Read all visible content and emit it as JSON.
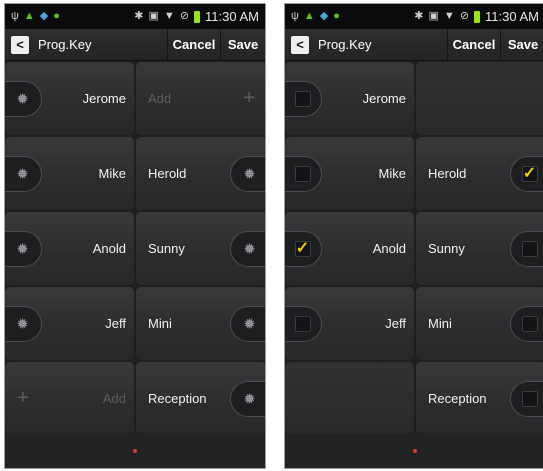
{
  "status": {
    "time": "11:30 AM"
  },
  "header": {
    "title": "Prog.Key",
    "cancel": "Cancel",
    "save": "Save"
  },
  "left": {
    "rows": [
      {
        "left": "Jerome",
        "right": "Add"
      },
      {
        "left": "Mike",
        "right": "Herold"
      },
      {
        "left": "Anold",
        "right": "Sunny"
      },
      {
        "left": "Jeff",
        "right": "Mini"
      },
      {
        "left": "Add",
        "right": "Reception"
      }
    ]
  },
  "right": {
    "rows": [
      {
        "left": "Jerome",
        "left_checked": false
      },
      {
        "left": "Mike",
        "left_checked": false,
        "right": "Herold",
        "right_checked": true
      },
      {
        "left": "Anold",
        "left_checked": true,
        "right": "Sunny",
        "right_checked": false
      },
      {
        "left": "Jeff",
        "left_checked": false,
        "right": "Mini",
        "right_checked": false
      },
      {
        "right": "Reception",
        "right_checked": false
      }
    ]
  },
  "icons": {
    "settings": "gear-icon",
    "add": "plus-icon",
    "check": "checkmark-icon",
    "back": "back-arrow-icon"
  },
  "colors": {
    "accent_check": "#f0d000",
    "page_indicator": "#d83a2f"
  }
}
